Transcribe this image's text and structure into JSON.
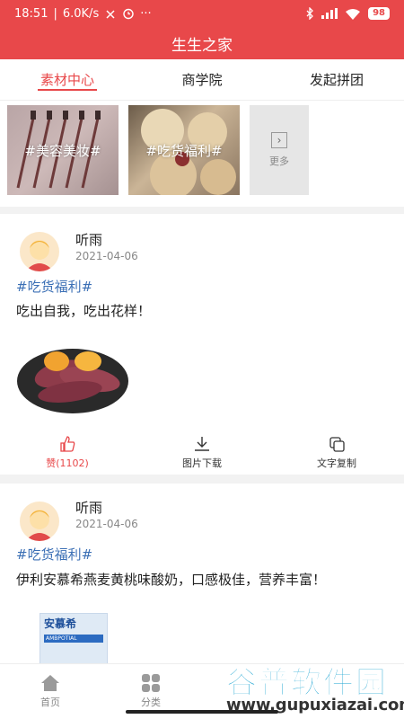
{
  "statusbar": {
    "time": "18:51",
    "speed": "6.0K/s",
    "battery": "98"
  },
  "appbar": {
    "title": "生生之家"
  },
  "tabs": [
    {
      "label": "素材中心",
      "active": true
    },
    {
      "label": "商学院",
      "active": false
    },
    {
      "label": "发起拼团",
      "active": false
    }
  ],
  "categories": [
    {
      "label": "#美容美妆#",
      "icon": "makeup-brush-photo"
    },
    {
      "label": "#吃货福利#",
      "icon": "food-pastry-photo"
    },
    {
      "label": "更多",
      "icon": "chevron-right-box-icon"
    }
  ],
  "posts": [
    {
      "user": "听雨",
      "date": "2021-04-06",
      "topic": "#吃货福利#",
      "text": "吃出自我，吃出花样！",
      "image": "roasted-sweet-potato-photo"
    },
    {
      "user": "听雨",
      "date": "2021-04-06",
      "topic": "#吃货福利#",
      "text": "伊利安慕希燕麦黄桃味酸奶，口感极佳，营养丰富！",
      "image": "yogurt-product-photo",
      "product_brand": "安慕希",
      "product_sub": "AMBPOTIAL"
    }
  ],
  "actions": {
    "like": "赞(1102)",
    "download": "图片下载",
    "copy": "文字复制"
  },
  "bottomnav": [
    {
      "label": "首页",
      "icon": "home-icon"
    },
    {
      "label": "分类",
      "icon": "grid-icon"
    }
  ],
  "watermark": {
    "title": "谷普软件园",
    "url": "www.gupuxiazai.com"
  },
  "colors": {
    "brand": "#e8484a",
    "topic": "#3b6fb5"
  }
}
